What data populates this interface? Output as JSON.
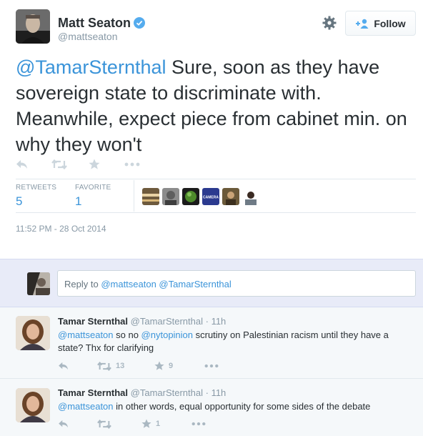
{
  "tweet": {
    "author_name": "Matt Seaton",
    "author_handle": "@mattseaton",
    "follow_label": "Follow",
    "text_mention": "@TamarSternthal",
    "text_body": " Sure, soon as they have sovereign state to discriminate with. Meanwhile, expect piece from cabinet min. on why they won't",
    "retweets_label": "RETWEETS",
    "retweets_count": "5",
    "favorites_label": "FAVORITE",
    "favorites_count": "1",
    "timestamp": "11:52 PM - 28 Oct 2014",
    "faver_icons": [
      "faver-avatar-1",
      "faver-avatar-2",
      "faver-avatar-3",
      "faver-avatar-camera",
      "faver-avatar-5",
      "faver-avatar-6"
    ],
    "camera_label": "CAMERA"
  },
  "reply_box": {
    "prefix": "Reply to ",
    "mentions": "@mattseaton @TamarSternthal"
  },
  "replies": [
    {
      "name": "Tamar Sternthal",
      "handle": "@TamarSternthal",
      "time": "· 11h",
      "mention1": "@mattseaton",
      "text1": " so no ",
      "mention2": "@nytopinion",
      "text2": " scrutiny on Palestinian racism until they have a state? Thx for clarifying",
      "retweet_count": "13",
      "favorite_count": "9"
    },
    {
      "name": "Tamar Sternthal",
      "handle": "@TamarSternthal",
      "time": "· 11h",
      "mention1": "@mattseaton",
      "text1": " in other words, equal opportunity for some sides of the debate",
      "retweet_count": "",
      "favorite_count": "1"
    }
  ],
  "colors": {
    "link": "#3b94d9",
    "muted": "#8899a6",
    "icon": "#ccd6dd",
    "reply_bg": "#e8ebf8",
    "thread_bg": "#f5f8fa"
  },
  "icons": [
    "verified-badge-icon",
    "gear-icon",
    "follow-person-plus-icon",
    "reply-arrow-icon",
    "retweet-icon",
    "star-icon",
    "more-dots-icon"
  ]
}
